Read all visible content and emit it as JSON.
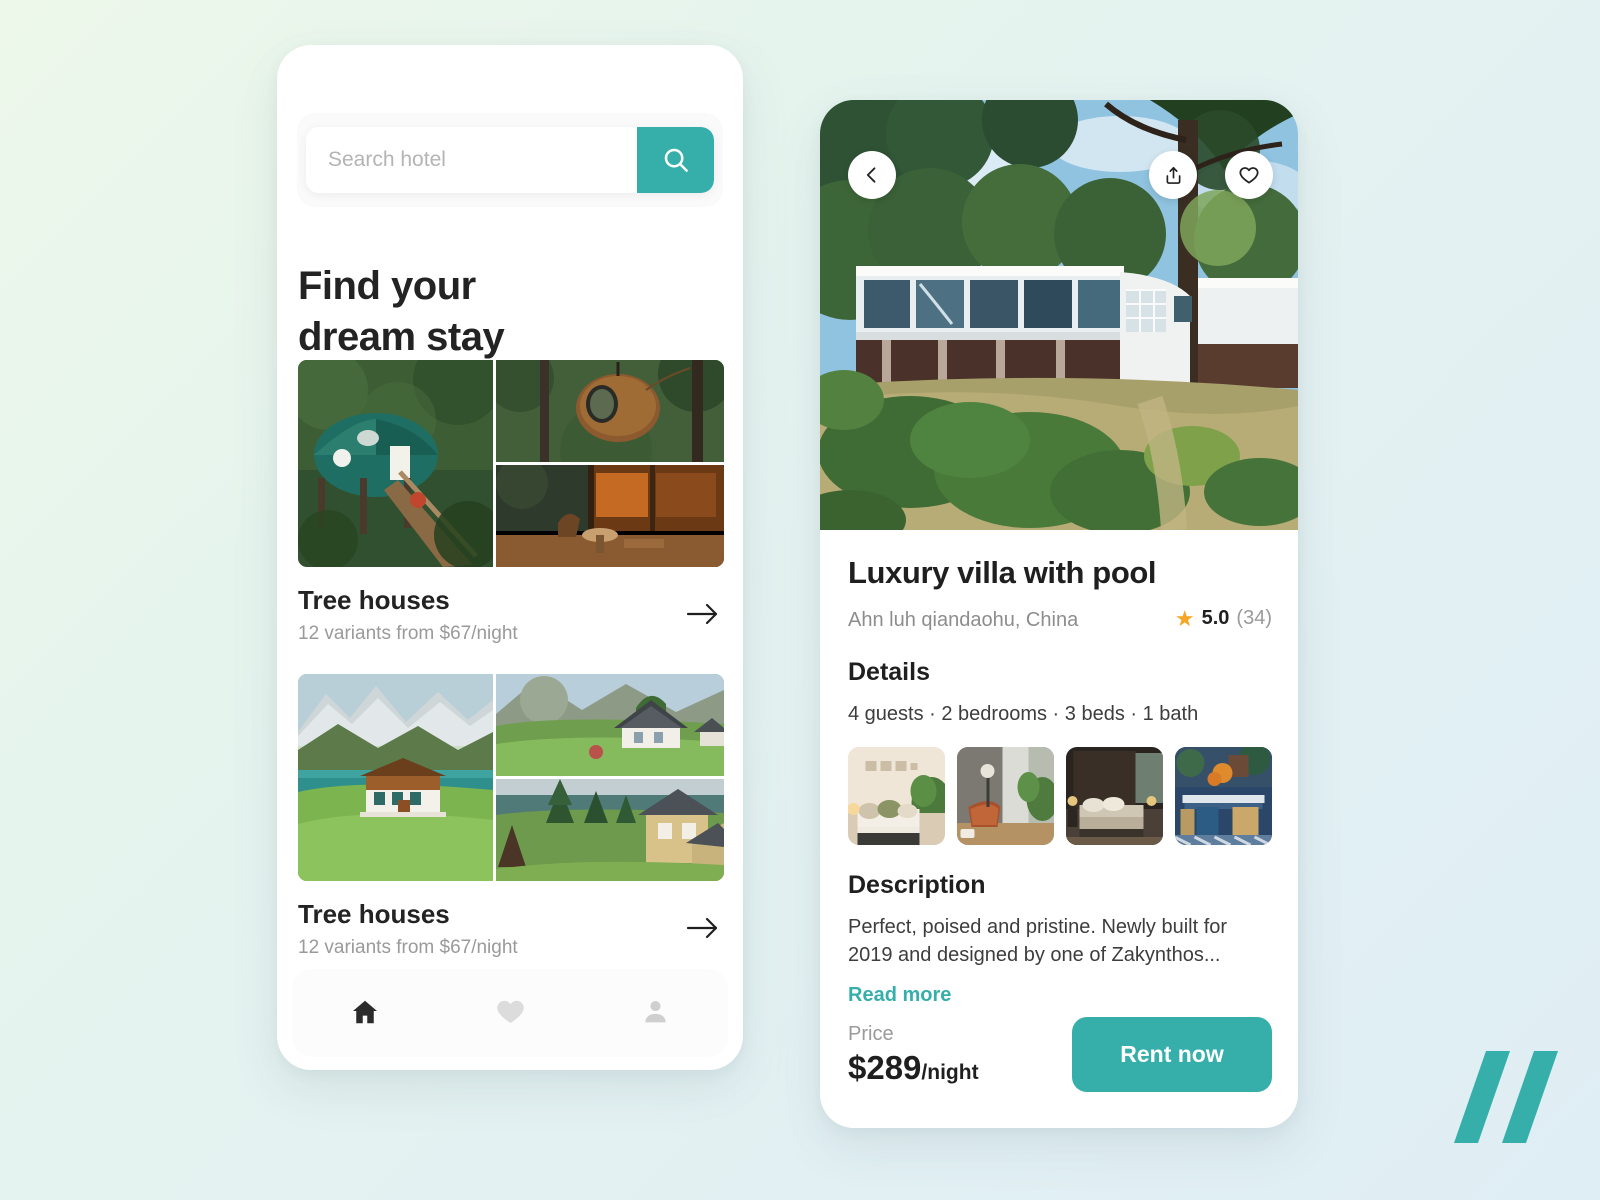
{
  "background": {
    "from": "#EDF8EA",
    "to": "#DFEEF5"
  },
  "brand": {
    "accent": "#36AFAB",
    "star": "#F5A623"
  },
  "left_phone": {
    "search": {
      "placeholder": "Search hotel",
      "value": "",
      "button_icon": "search-icon"
    },
    "headline": "Find your\ndream stay",
    "categories": [
      {
        "title": "Tree houses",
        "subtitle": "12 variants from $67/night",
        "arrow_icon": "arrow-right-icon",
        "images": [
          "geodesic-dome-treehouse",
          "spherical-tree-pod",
          "wooden-cabin-interior"
        ]
      },
      {
        "title": "Tree houses",
        "subtitle": "12 variants from $67/night",
        "arrow_icon": "arrow-right-icon",
        "images": [
          "alpine-chalet-by-lake",
          "mountain-farmhouse",
          "lakeside-yellow-house"
        ]
      }
    ],
    "tabbar": [
      {
        "name": "home",
        "icon": "home-icon",
        "active": true
      },
      {
        "name": "favorites",
        "icon": "heart-icon",
        "active": false
      },
      {
        "name": "profile",
        "icon": "person-icon",
        "active": false
      }
    ]
  },
  "right_phone": {
    "hero": {
      "image": "modern-white-villa-in-forest",
      "alt": "Luxury villa exterior"
    },
    "hero_actions": [
      {
        "name": "back",
        "icon": "chevron-left-icon"
      },
      {
        "name": "share",
        "icon": "share-icon"
      },
      {
        "name": "favorite",
        "icon": "heart-outline-icon"
      }
    ],
    "title": "Luxury villa with pool",
    "location": "Ahn luh qiandaohu, China",
    "rating": {
      "star_icon": "star-icon",
      "value": "5.0",
      "count": "(34)"
    },
    "details": {
      "heading": "Details",
      "summary": "4 guests · 2 bedrooms · 3 beds · 1 bath",
      "thumbnails": [
        "bedroom-beige-plants",
        "bathroom-copper-tub",
        "dark-wood-bedroom",
        "blue-patio-furniture"
      ]
    },
    "description": {
      "heading": "Description",
      "body": "Perfect, poised and pristine. Newly built for 2019 and designed by one of Zakynthos...",
      "read_more": "Read more"
    },
    "price": {
      "label": "Price",
      "amount": "$289",
      "unit": "/night"
    },
    "cta": "Rent now"
  },
  "logo": {
    "name": "double-slash-logo",
    "color": "#36AFAB"
  }
}
